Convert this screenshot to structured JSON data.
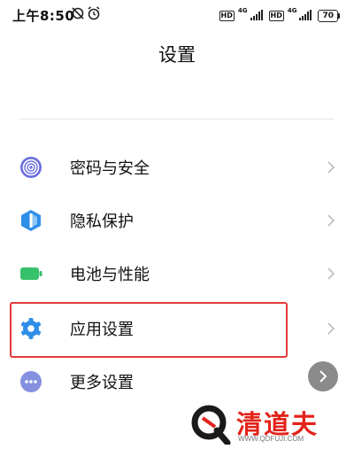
{
  "status_bar": {
    "time": "上午8:50",
    "icons": [
      "sync-off-icon",
      "alarm-icon"
    ],
    "hd1": "HD",
    "net1": "4G",
    "hd2": "HD",
    "net2": "4G",
    "battery": "70"
  },
  "header": {
    "title": "设置"
  },
  "settings": {
    "items": [
      {
        "label": "密码与安全",
        "icon": "fingerprint-icon",
        "color": "#6b6fe0"
      },
      {
        "label": "隐私保护",
        "icon": "shield-icon",
        "color": "#2f8fe8"
      },
      {
        "label": "电池与性能",
        "icon": "battery-icon",
        "color": "#35c26b"
      },
      {
        "label": "应用设置",
        "icon": "gear-icon",
        "color": "#2f8fe8"
      },
      {
        "label": "更多设置",
        "icon": "more-dots-icon",
        "color": "#8590e0"
      }
    ]
  },
  "annotation": {
    "highlight_color": "#e53a3a"
  },
  "watermark": {
    "brand": "清道夫",
    "url": "WWW.QDFUJI.COM"
  }
}
